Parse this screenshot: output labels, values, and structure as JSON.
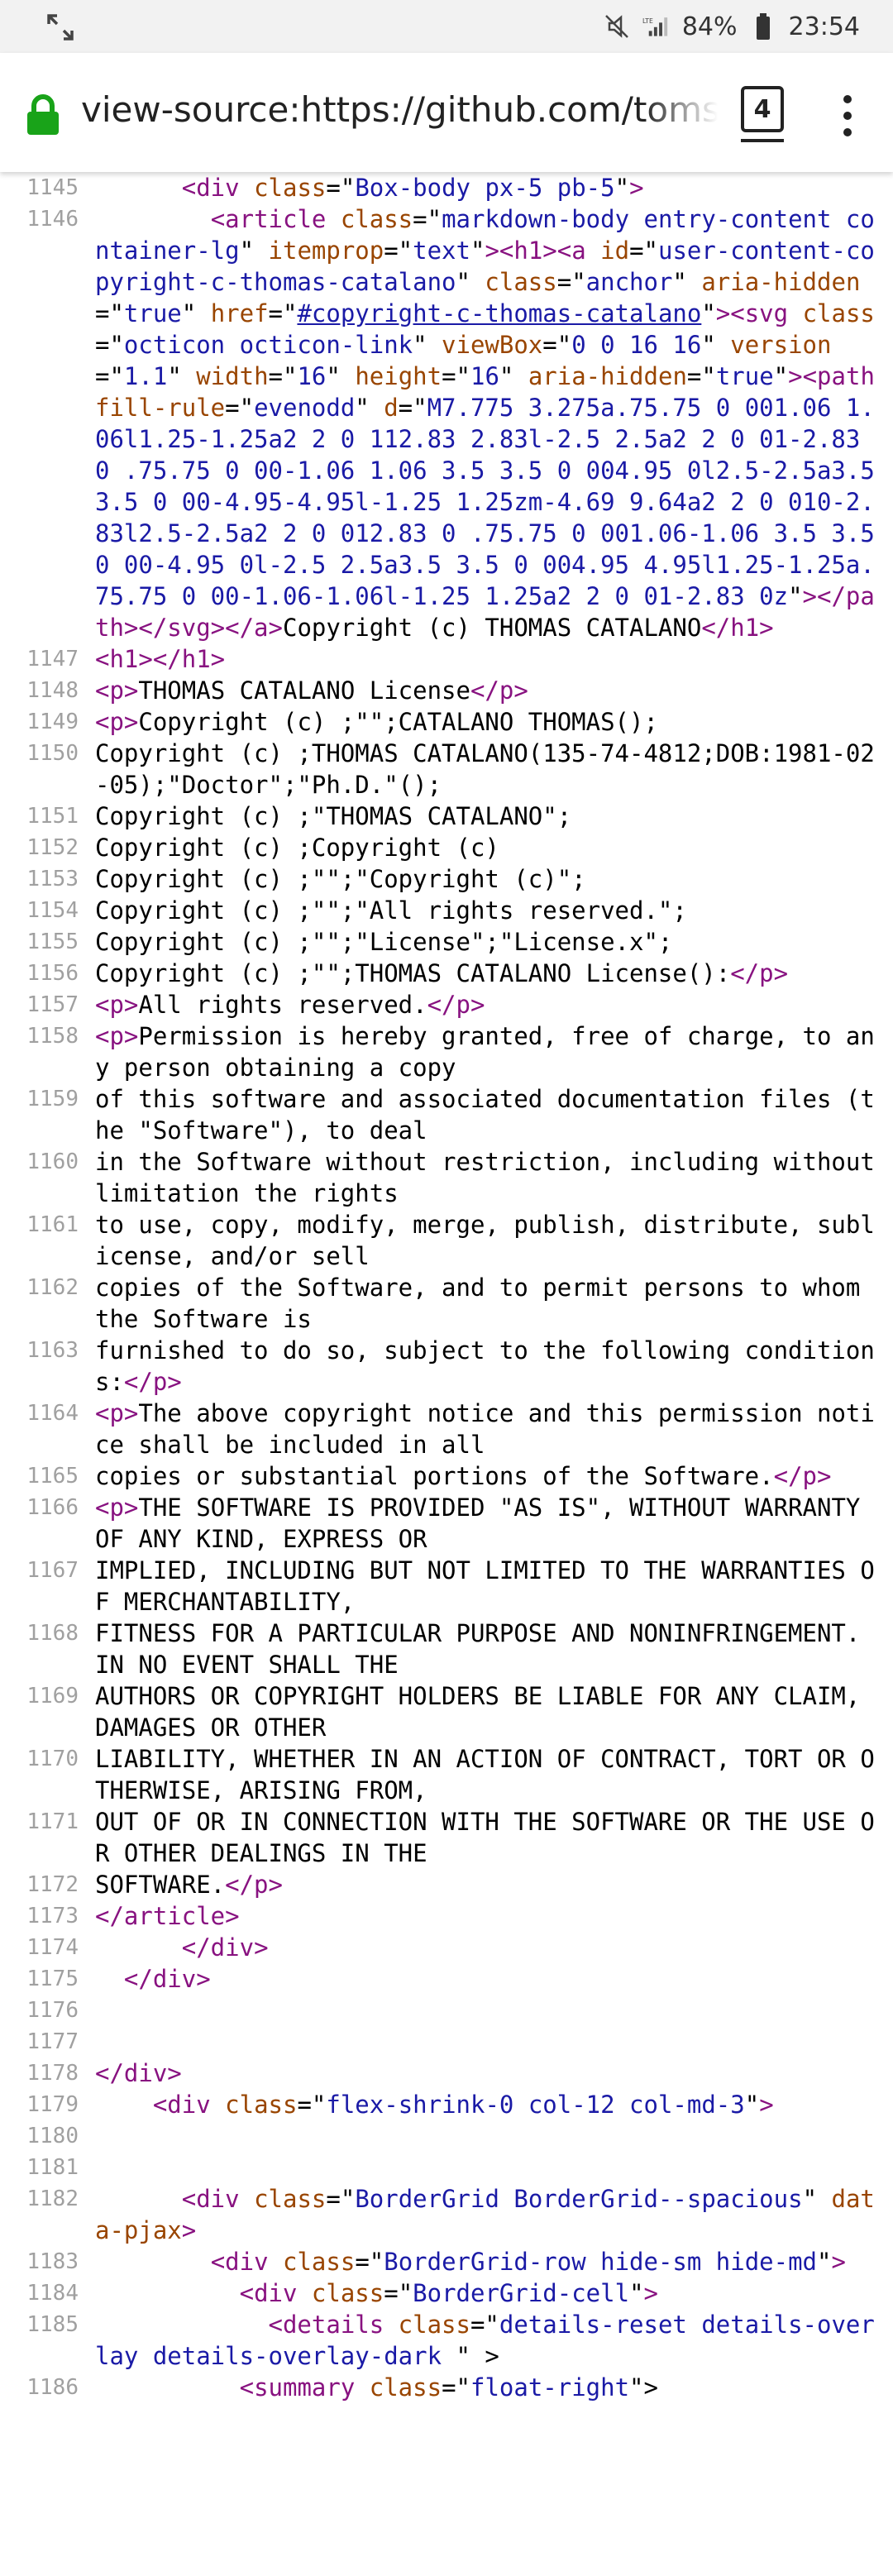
{
  "status_bar": {
    "battery": "84%",
    "network": "LTE",
    "time": "23:54",
    "icons": [
      "screen-expand-icon",
      "mute-icon",
      "lte-signal-icon",
      "battery-icon"
    ]
  },
  "address_bar": {
    "url": "view-source:https://github.com/toms",
    "tab_count": "4",
    "icons": [
      "lock-icon",
      "tabs-icon",
      "menu-icon"
    ]
  },
  "source": {
    "rows": [
      {
        "n": "1145",
        "tokens": [
          [
            "",
            "      "
          ],
          [
            "t",
            "<div "
          ],
          [
            "a",
            "class"
          ],
          [
            "",
            "=\""
          ],
          [
            "v",
            "Box-body px-5 pb-5"
          ],
          [
            "",
            "\""
          ],
          [
            "t",
            ">"
          ]
        ]
      },
      {
        "n": "1146",
        "tokens": [
          [
            "",
            "        "
          ],
          [
            "t",
            "<article "
          ],
          [
            "a",
            "class"
          ],
          [
            "",
            "=\""
          ],
          [
            "v",
            "markdown-body entry-content container-lg"
          ],
          [
            "",
            "\" "
          ],
          [
            "a",
            "itemprop"
          ],
          [
            "",
            "=\""
          ],
          [
            "v",
            "text"
          ],
          [
            "",
            "\""
          ],
          [
            "t",
            "><h1><a "
          ],
          [
            "a",
            "id"
          ],
          [
            "",
            "=\""
          ],
          [
            "v",
            "user-content-copyright-c-thomas-catalano"
          ],
          [
            "",
            "\" "
          ],
          [
            "a",
            "class"
          ],
          [
            "",
            "=\""
          ],
          [
            "v",
            "anchor"
          ],
          [
            "",
            "\" "
          ],
          [
            "a",
            "aria-hidden"
          ],
          [
            "",
            "=\""
          ],
          [
            "v",
            "true"
          ],
          [
            "",
            "\" "
          ],
          [
            "a",
            "href"
          ],
          [
            "",
            "=\""
          ],
          [
            "lk",
            "#copyright-c-thomas-catalano"
          ],
          [
            "",
            "\""
          ],
          [
            "t",
            "><svg "
          ],
          [
            "a",
            "class"
          ],
          [
            "",
            "=\""
          ],
          [
            "v",
            "octicon octicon-link"
          ],
          [
            "",
            "\" "
          ],
          [
            "a",
            "viewBox"
          ],
          [
            "",
            "=\""
          ],
          [
            "v",
            "0 0 16 16"
          ],
          [
            "",
            "\" "
          ],
          [
            "a",
            "version"
          ],
          [
            "",
            "=\""
          ],
          [
            "v",
            "1.1"
          ],
          [
            "",
            "\" "
          ],
          [
            "a",
            "width"
          ],
          [
            "",
            "=\""
          ],
          [
            "v",
            "16"
          ],
          [
            "",
            "\" "
          ],
          [
            "a",
            "height"
          ],
          [
            "",
            "=\""
          ],
          [
            "v",
            "16"
          ],
          [
            "",
            "\" "
          ],
          [
            "a",
            "aria-hidden"
          ],
          [
            "",
            "=\""
          ],
          [
            "v",
            "true"
          ],
          [
            "",
            "\""
          ],
          [
            "t",
            "><path "
          ],
          [
            "a",
            "fill-rule"
          ],
          [
            "",
            "=\""
          ],
          [
            "v",
            "evenodd"
          ],
          [
            "",
            "\" "
          ],
          [
            "a",
            "d"
          ],
          [
            "",
            "=\""
          ],
          [
            "v",
            "M7.775 3.275a.75.75 0 001.06 1.06l1.25-1.25a2 2 0 112.83 2.83l-2.5 2.5a2 2 0 01-2.83 0 .75.75 0 00-1.06 1.06 3.5 3.5 0 004.95 0l2.5-2.5a3.5 3.5 0 00-4.95-4.95l-1.25 1.25zm-4.69 9.64a2 2 0 010-2.83l2.5-2.5a2 2 0 012.83 0 .75.75 0 001.06-1.06 3.5 3.5 0 00-4.95 0l-2.5 2.5a3.5 3.5 0 004.95 4.95l1.25-1.25a.75.75 0 00-1.06-1.06l-1.25 1.25a2 2 0 01-2.83 0z"
          ],
          [
            "",
            "\""
          ],
          [
            "t",
            "></path></svg></a>"
          ],
          [
            "",
            "Copyright (c) THOMAS CATALANO"
          ],
          [
            "t",
            "</h1>"
          ]
        ]
      },
      {
        "n": "1147",
        "tokens": [
          [
            "t",
            "<h1></h1>"
          ]
        ]
      },
      {
        "n": "1148",
        "tokens": [
          [
            "t",
            "<p>"
          ],
          [
            "",
            "THOMAS CATALANO License"
          ],
          [
            "t",
            "</p>"
          ]
        ]
      },
      {
        "n": "1149",
        "tokens": [
          [
            "t",
            "<p>"
          ],
          [
            "",
            "Copyright (c) ;\"\";CATALANO THOMAS();"
          ]
        ]
      },
      {
        "n": "1150",
        "tokens": [
          [
            "",
            "Copyright (c) ;THOMAS CATALANO(135-74-4812;DOB:1981-02-05);\"Doctor\";\"Ph.D.\"();"
          ]
        ]
      },
      {
        "n": "1151",
        "tokens": [
          [
            "",
            "Copyright (c) ;\"THOMAS CATALANO\";"
          ]
        ]
      },
      {
        "n": "1152",
        "tokens": [
          [
            "",
            "Copyright (c) ;Copyright (c)"
          ]
        ]
      },
      {
        "n": "1153",
        "tokens": [
          [
            "",
            "Copyright (c) ;\"\";\"Copyright (c)\";"
          ]
        ]
      },
      {
        "n": "1154",
        "tokens": [
          [
            "",
            "Copyright (c) ;\"\";\"All rights reserved.\";"
          ]
        ]
      },
      {
        "n": "1155",
        "tokens": [
          [
            "",
            "Copyright (c) ;\"\";\"License\";\"License.x\";"
          ]
        ]
      },
      {
        "n": "1156",
        "tokens": [
          [
            "",
            "Copyright (c) ;\"\";THOMAS CATALANO License():"
          ],
          [
            "t",
            "</p>"
          ]
        ]
      },
      {
        "n": "1157",
        "tokens": [
          [
            "t",
            "<p>"
          ],
          [
            "",
            "All rights reserved."
          ],
          [
            "t",
            "</p>"
          ]
        ]
      },
      {
        "n": "1158",
        "tokens": [
          [
            "t",
            "<p>"
          ],
          [
            "",
            "Permission is hereby granted, free of charge, to any person obtaining a copy"
          ]
        ]
      },
      {
        "n": "1159",
        "tokens": [
          [
            "",
            "of this software and associated documentation files (the \"Software\"), to deal"
          ]
        ]
      },
      {
        "n": "1160",
        "tokens": [
          [
            "",
            "in the Software without restriction, including without limitation the rights"
          ]
        ]
      },
      {
        "n": "1161",
        "tokens": [
          [
            "",
            "to use, copy, modify, merge, publish, distribute, sublicense, and/or sell"
          ]
        ]
      },
      {
        "n": "1162",
        "tokens": [
          [
            "",
            "copies of the Software, and to permit persons to whom the Software is"
          ]
        ]
      },
      {
        "n": "1163",
        "tokens": [
          [
            "",
            "furnished to do so, subject to the following conditions:"
          ],
          [
            "t",
            "</p>"
          ]
        ]
      },
      {
        "n": "1164",
        "tokens": [
          [
            "t",
            "<p>"
          ],
          [
            "",
            "The above copyright notice and this permission notice shall be included in all"
          ]
        ]
      },
      {
        "n": "1165",
        "tokens": [
          [
            "",
            "copies or substantial portions of the Software."
          ],
          [
            "t",
            "</p>"
          ]
        ]
      },
      {
        "n": "1166",
        "tokens": [
          [
            "t",
            "<p>"
          ],
          [
            "",
            "THE SOFTWARE IS PROVIDED \"AS IS\", WITHOUT WARRANTY OF ANY KIND, EXPRESS OR"
          ]
        ]
      },
      {
        "n": "1167",
        "tokens": [
          [
            "",
            "IMPLIED, INCLUDING BUT NOT LIMITED TO THE WARRANTIES OF MERCHANTABILITY,"
          ]
        ]
      },
      {
        "n": "1168",
        "tokens": [
          [
            "",
            "FITNESS FOR A PARTICULAR PURPOSE AND NONINFRINGEMENT. IN NO EVENT SHALL THE"
          ]
        ]
      },
      {
        "n": "1169",
        "tokens": [
          [
            "",
            "AUTHORS OR COPYRIGHT HOLDERS BE LIABLE FOR ANY CLAIM, DAMAGES OR OTHER"
          ]
        ]
      },
      {
        "n": "1170",
        "tokens": [
          [
            "",
            "LIABILITY, WHETHER IN AN ACTION OF CONTRACT, TORT OR OTHERWISE, ARISING FROM,"
          ]
        ]
      },
      {
        "n": "1171",
        "tokens": [
          [
            "",
            "OUT OF OR IN CONNECTION WITH THE SOFTWARE OR THE USE OR OTHER DEALINGS IN THE"
          ]
        ]
      },
      {
        "n": "1172",
        "tokens": [
          [
            "",
            "SOFTWARE."
          ],
          [
            "t",
            "</p>"
          ]
        ]
      },
      {
        "n": "1173",
        "tokens": [
          [
            "t",
            "</article>"
          ]
        ]
      },
      {
        "n": "1174",
        "tokens": [
          [
            "",
            "      "
          ],
          [
            "t",
            "</div>"
          ]
        ]
      },
      {
        "n": "1175",
        "tokens": [
          [
            "",
            "  "
          ],
          [
            "t",
            "</div>"
          ]
        ]
      },
      {
        "n": "1176",
        "tokens": [
          [
            "",
            ""
          ]
        ]
      },
      {
        "n": "1177",
        "tokens": [
          [
            "",
            ""
          ]
        ]
      },
      {
        "n": "1178",
        "tokens": [
          [
            "t",
            "</div>"
          ]
        ]
      },
      {
        "n": "1179",
        "tokens": [
          [
            "",
            "    "
          ],
          [
            "t",
            "<div "
          ],
          [
            "a",
            "class"
          ],
          [
            "",
            "=\""
          ],
          [
            "v",
            "flex-shrink-0 col-12 col-md-3"
          ],
          [
            "",
            "\""
          ],
          [
            "t",
            ">"
          ]
        ]
      },
      {
        "n": "1180",
        "tokens": [
          [
            "",
            ""
          ]
        ]
      },
      {
        "n": "1181",
        "tokens": [
          [
            "",
            ""
          ]
        ]
      },
      {
        "n": "1182",
        "tokens": [
          [
            "",
            "      "
          ],
          [
            "t",
            "<div "
          ],
          [
            "a",
            "class"
          ],
          [
            "",
            "=\""
          ],
          [
            "v",
            "BorderGrid BorderGrid--spacious"
          ],
          [
            "",
            "\" "
          ],
          [
            "a",
            "data-pjax"
          ],
          [
            "t",
            ">"
          ]
        ]
      },
      {
        "n": "1183",
        "tokens": [
          [
            "",
            "        "
          ],
          [
            "t",
            "<div "
          ],
          [
            "a",
            "class"
          ],
          [
            "",
            "=\""
          ],
          [
            "v",
            "BorderGrid-row hide-sm hide-md"
          ],
          [
            "",
            "\""
          ],
          [
            "t",
            ">"
          ]
        ]
      },
      {
        "n": "1184",
        "tokens": [
          [
            "",
            "          "
          ],
          [
            "t",
            "<div "
          ],
          [
            "a",
            "class"
          ],
          [
            "",
            "=\""
          ],
          [
            "v",
            "BorderGrid-cell"
          ],
          [
            "",
            "\""
          ],
          [
            "t",
            ">"
          ]
        ]
      },
      {
        "n": "1185",
        "tokens": [
          [
            "",
            "            "
          ],
          [
            "t",
            "<details "
          ],
          [
            "a",
            "class"
          ],
          [
            "",
            "=\""
          ],
          [
            "v",
            "details-reset details-overlay details-overlay-dark"
          ],
          [
            "",
            " \" >"
          ]
        ]
      },
      {
        "n": "1186",
        "tokens": [
          [
            "",
            "          "
          ],
          [
            "t",
            "<summary "
          ],
          [
            "a",
            "class"
          ],
          [
            "",
            "=\""
          ],
          [
            "v",
            "float-right"
          ],
          [
            "",
            "\">"
          ]
        ]
      }
    ]
  }
}
